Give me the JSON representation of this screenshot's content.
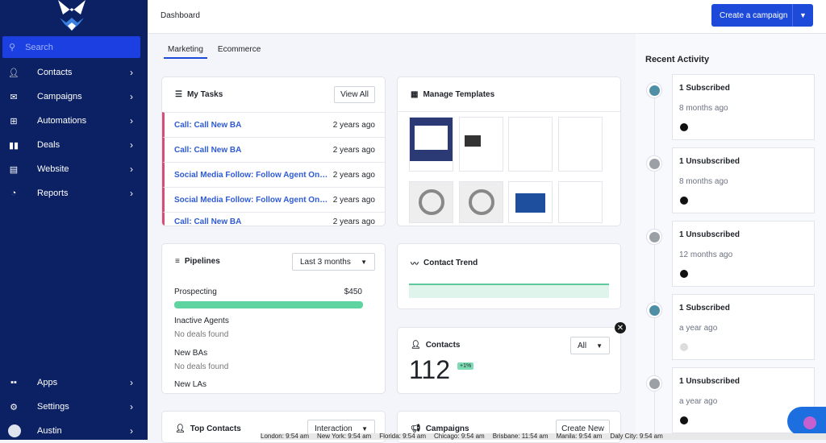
{
  "sidebar": {
    "search": "Search",
    "items": [
      {
        "label": "Contacts",
        "icon": "person-icon"
      },
      {
        "label": "Campaigns",
        "icon": "mail-icon"
      },
      {
        "label": "Automations",
        "icon": "automation-icon"
      },
      {
        "label": "Deals",
        "icon": "deals-icon"
      },
      {
        "label": "Website",
        "icon": "website-icon"
      },
      {
        "label": "Reports",
        "icon": "pie-icon"
      }
    ],
    "bottom": [
      {
        "label": "Apps"
      },
      {
        "label": "Settings"
      },
      {
        "label": "Austin"
      }
    ]
  },
  "header": {
    "title": "Dashboard",
    "create": "Create a campaign"
  },
  "tabs": [
    "Marketing",
    "Ecommerce"
  ],
  "tasks": {
    "title": "My Tasks",
    "view_all": "View All",
    "rows": [
      {
        "name": "Call: Call New BA",
        "time": "2 years ago"
      },
      {
        "name": "Call: Call New BA",
        "time": "2 years ago"
      },
      {
        "name": "Social Media Follow: Follow Agent On S...",
        "time": "2 years ago"
      },
      {
        "name": "Social Media Follow: Follow Agent On S...",
        "time": "2 years ago"
      },
      {
        "name": "Call: Call New BA",
        "time": "2 years ago"
      }
    ]
  },
  "templates": {
    "title": "Manage Templates"
  },
  "pipelines": {
    "title": "Pipelines",
    "filter": "Last 3 months",
    "items": [
      {
        "name": "Prospecting",
        "value": "$450",
        "progress": 100
      },
      {
        "name": "Inactive Agents",
        "empty": "No deals found"
      },
      {
        "name": "New BAs",
        "empty": "No deals found"
      },
      {
        "name": "New LAs"
      }
    ]
  },
  "trend": {
    "title": "Contact Trend"
  },
  "contacts": {
    "title": "Contacts",
    "filter": "All",
    "count": "112",
    "change": "+1%"
  },
  "top_contacts": {
    "title": "Top Contacts",
    "filter": "Interaction"
  },
  "campaigns": {
    "title": "Campaigns",
    "create": "Create New"
  },
  "activity": {
    "title": "Recent Activity",
    "items": [
      {
        "label": "1 Subscribed",
        "time": "8 months ago",
        "type": "sub"
      },
      {
        "label": "1 Unsubscribed",
        "time": "8 months ago",
        "type": "unsub"
      },
      {
        "label": "1 Unsubscribed",
        "time": "12 months ago",
        "type": "unsub"
      },
      {
        "label": "1 Subscribed",
        "time": "a year ago",
        "type": "sub"
      },
      {
        "label": "1 Unsubscribed",
        "time": "a year ago",
        "type": "unsub"
      }
    ]
  },
  "clocks": [
    "London: 9:54 am",
    "New York: 9:54 am",
    "Florida: 9:54 am",
    "Chicago: 9:54 am",
    "Brisbane: 11:54 am",
    "Manila: 9:54 am",
    "Daly City: 9:54 am"
  ],
  "colors": {
    "sidebar": "#0b2163",
    "accent": "#1d4ad8",
    "success": "#5fd3a0",
    "task_border": "#d64d78"
  }
}
